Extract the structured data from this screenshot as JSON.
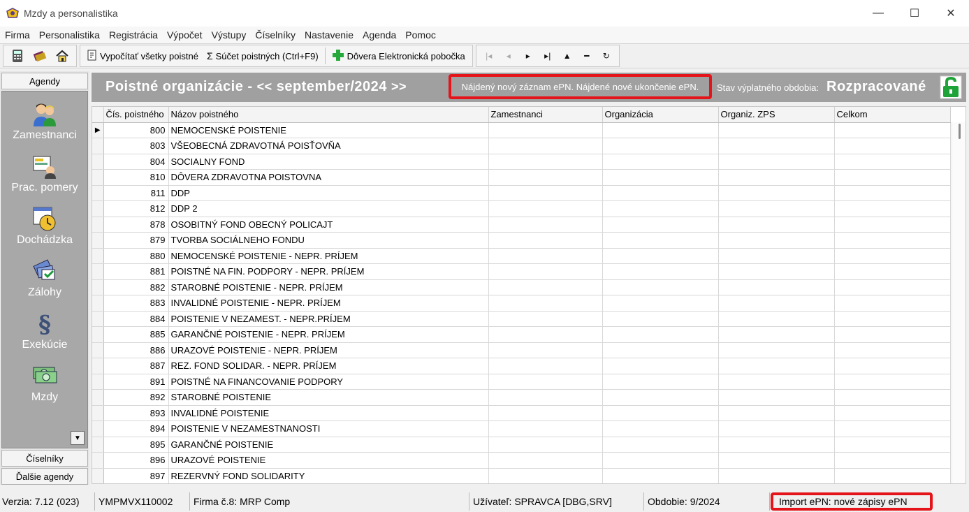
{
  "window": {
    "title": "Mzdy a personalistika",
    "controls": {
      "minimize": "—",
      "maximize": "☐",
      "close": "✕"
    }
  },
  "menu": [
    "Firma",
    "Personalistika",
    "Registrácia",
    "Výpočet",
    "Výstupy",
    "Číselníky",
    "Nastavenie",
    "Agenda",
    "Pomoc"
  ],
  "toolbar": {
    "calc_all": "Vypočítať všetky poistné",
    "sum": "Súčet poistných (Ctrl+F9)",
    "sum_glyph": "Σ",
    "branch": "Dôvera Elektronická pobočka",
    "nav": {
      "first": "|◂",
      "prev": "◂",
      "next": "▸",
      "last": "▸|",
      "up": "▲",
      "remove": "━",
      "refresh": "↻"
    }
  },
  "agenda": {
    "header": "Agendy",
    "items": [
      {
        "label": "Zamestnanci",
        "icon": "employees-icon"
      },
      {
        "label": "Prac. pomery",
        "icon": "work-relations-icon"
      },
      {
        "label": "Dochádzka",
        "icon": "attendance-icon"
      },
      {
        "label": "Zálohy",
        "icon": "advances-icon"
      },
      {
        "label": "Exekúcie",
        "icon": "execution-icon"
      },
      {
        "label": "Mzdy",
        "icon": "wages-icon"
      }
    ],
    "scroll_glyph": "▼",
    "footer": [
      "Číselníky",
      "Ďalšie agendy"
    ]
  },
  "header": {
    "title": "Poistné organizácie -",
    "prev": "<<",
    "period": "september/2024",
    "next": ">>",
    "message": "Nájdený nový záznam ePN. Nájdené nové ukončenie ePN.",
    "state_label": "Stav výplatného obdobia:",
    "state_value": "Rozpracované"
  },
  "grid": {
    "columns": [
      "Čís. poistného",
      "Názov poistného",
      "Zamestnanci",
      "Organizácia",
      "Organiz. ZPS",
      "Celkom"
    ],
    "current_row_indicator": "▶",
    "rows": [
      {
        "num": "800",
        "name": "NEMOCENSKÉ POISTENIE"
      },
      {
        "num": "803",
        "name": "VŠEOBECNÁ ZDRAVOTNÁ POISŤOVŇA"
      },
      {
        "num": "804",
        "name": "SOCIALNY FOND"
      },
      {
        "num": "810",
        "name": "DÔVERA ZDRAVOTNA POISTOVNA"
      },
      {
        "num": "811",
        "name": "DDP"
      },
      {
        "num": "812",
        "name": "DDP 2"
      },
      {
        "num": "878",
        "name": "OSOBITNÝ FOND OBECNÝ POLICAJT"
      },
      {
        "num": "879",
        "name": "TVORBA SOCIÁLNEHO FONDU"
      },
      {
        "num": "880",
        "name": "NEMOCENSKÉ POISTENIE - NEPR. PRÍJEM"
      },
      {
        "num": "881",
        "name": "POISTNÉ NA FIN. PODPORY - NEPR. PRÍJEM"
      },
      {
        "num": "882",
        "name": "STAROBNÉ POISTENIE - NEPR. PRÍJEM"
      },
      {
        "num": "883",
        "name": "INVALIDNÉ POISTENIE - NEPR. PRÍJEM"
      },
      {
        "num": "884",
        "name": "POISTENIE V NEZAMEST. - NEPR.PRÍJEM"
      },
      {
        "num": "885",
        "name": "GARANČNÉ POISTENIE - NEPR. PRÍJEM"
      },
      {
        "num": "886",
        "name": "URAZOVÉ POISTENIE - NEPR. PRÍJEM"
      },
      {
        "num": "887",
        "name": "REZ. FOND SOLIDAR. - NEPR. PRÍJEM"
      },
      {
        "num": "891",
        "name": "POISTNÉ NA FINANCOVANIE PODPORY"
      },
      {
        "num": "892",
        "name": "STAROBNÉ POISTENIE"
      },
      {
        "num": "893",
        "name": "INVALIDNÉ POISTENIE"
      },
      {
        "num": "894",
        "name": "POISTENIE V NEZAMESTNANOSTI"
      },
      {
        "num": "895",
        "name": "GARANČNÉ POISTENIE"
      },
      {
        "num": "896",
        "name": "URAZOVÉ POISTENIE"
      },
      {
        "num": "897",
        "name": "REZERVNÝ FOND SOLIDARITY"
      }
    ]
  },
  "status": {
    "version": "Verzia: 7.12 (023)",
    "machine": "YMPMVX110002",
    "company": "Firma č.8: MRP Comp",
    "user": "Užívateľ: SPRAVCA [DBG,SRV]",
    "period": "Obdobie: 9/2024",
    "import": "Import ePN: nové zápisy ePN"
  },
  "colors": {
    "accent_red": "#e5141a",
    "header_gray": "#a0a0a0",
    "agenda_gray": "#a8a8a8",
    "lock_green": "#1fa339"
  }
}
